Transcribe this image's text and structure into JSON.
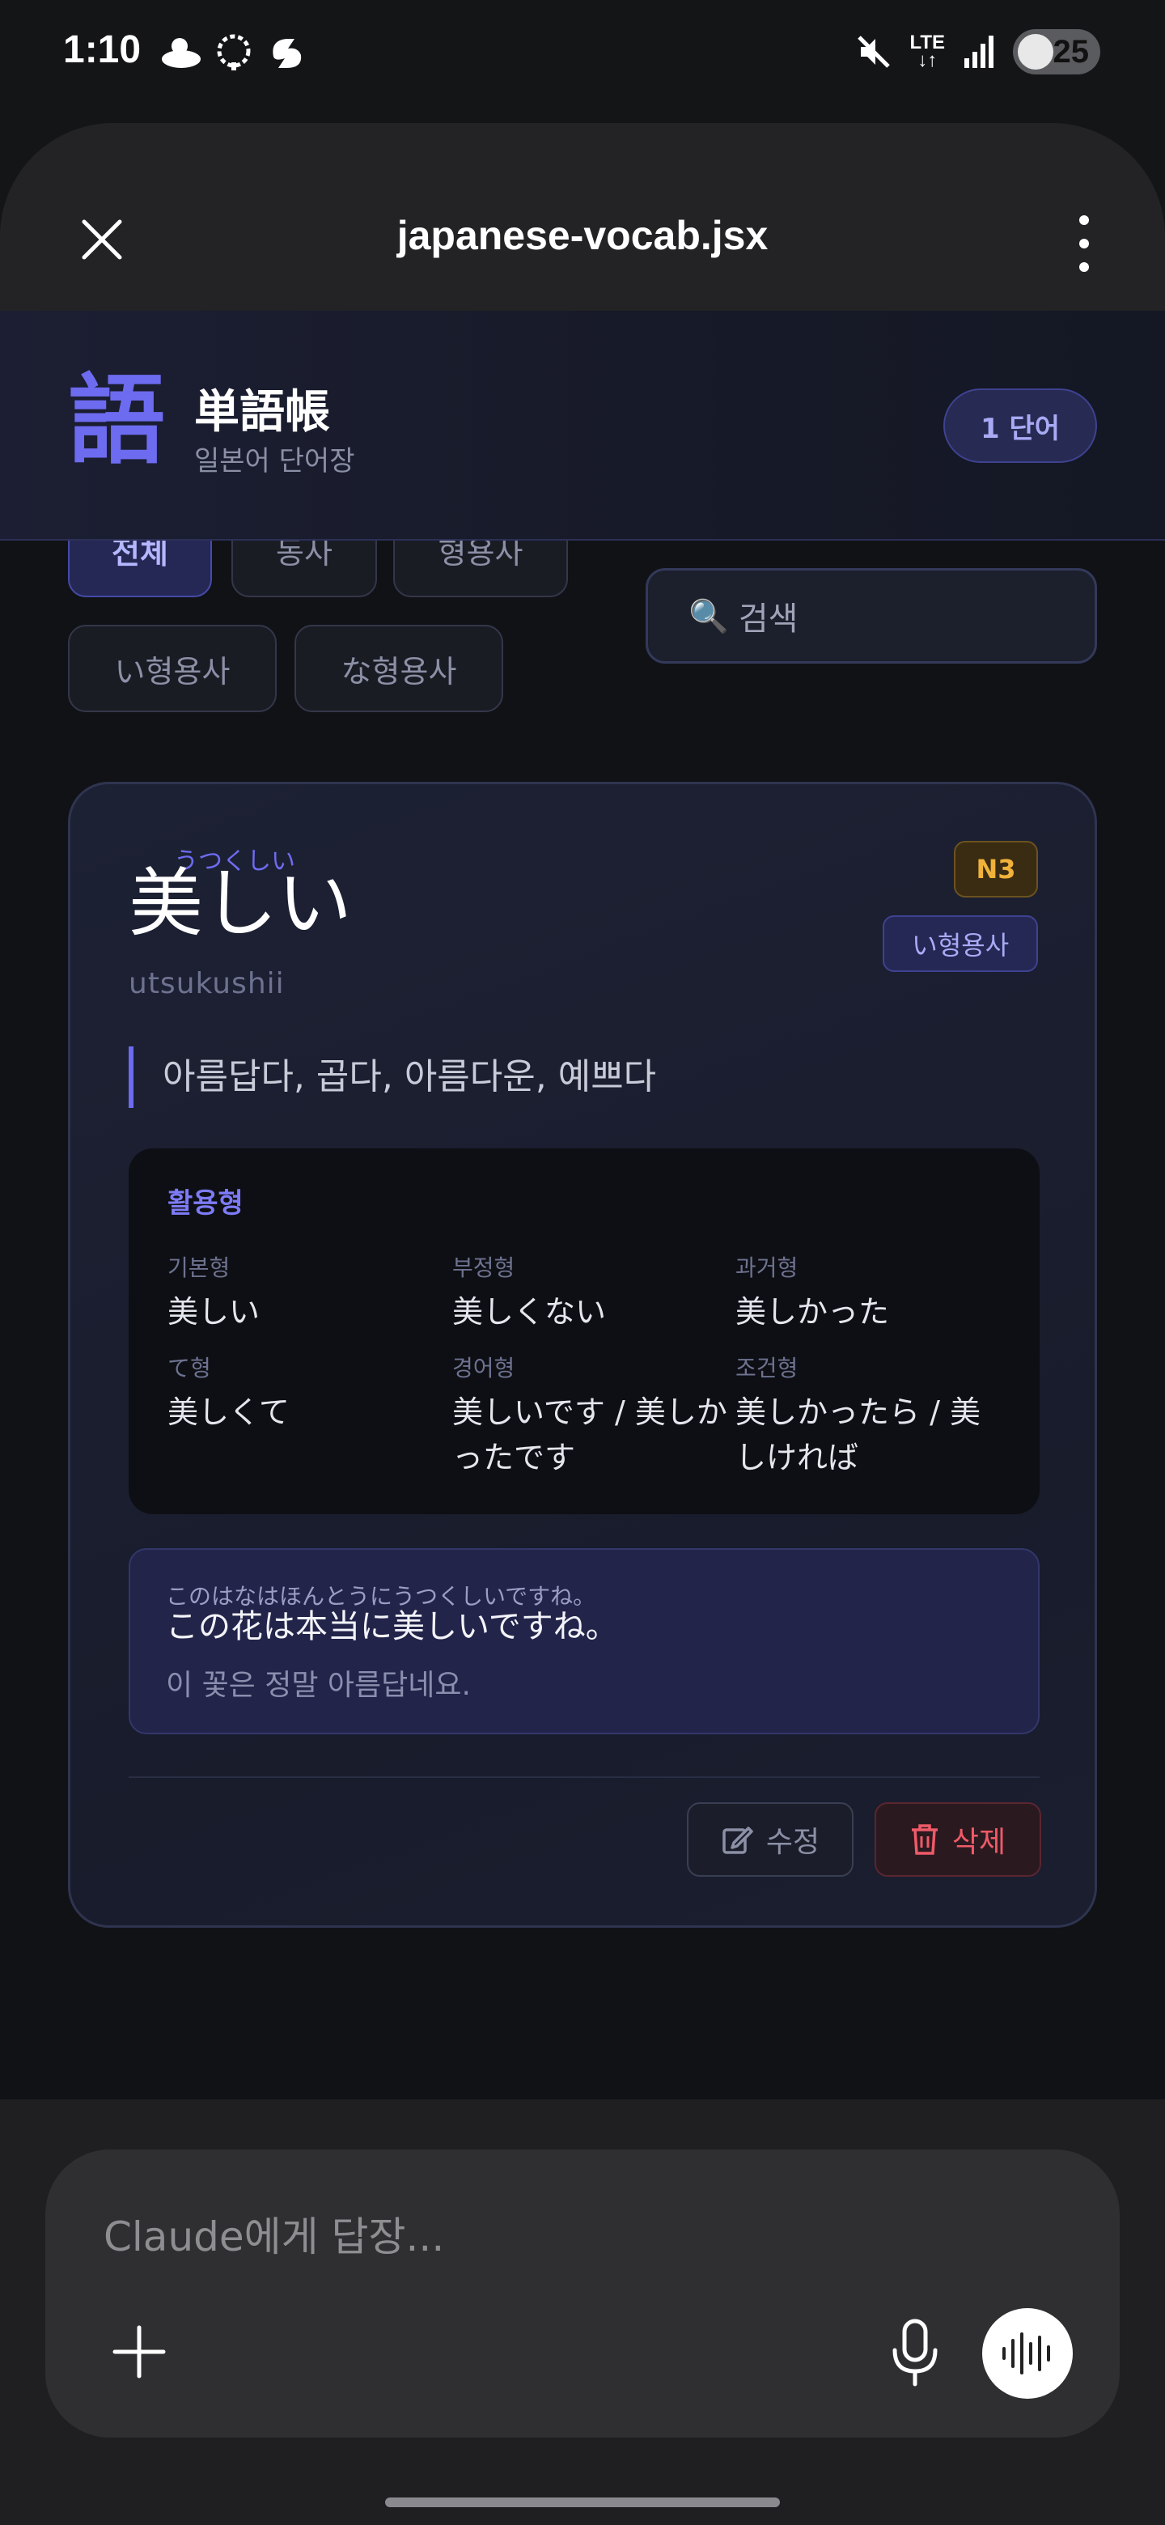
{
  "status_bar": {
    "time": "1:10",
    "network": "LTE",
    "battery": "25",
    "icons": [
      "cloud-sun-icon",
      "brain-icon",
      "sync-icon",
      "mute-icon",
      "signal-icon",
      "battery-icon"
    ]
  },
  "sheet": {
    "file_title": "japanese-vocab.jsx",
    "close_icon": "close-icon",
    "menu_icon": "more-vertical-icon"
  },
  "app": {
    "logo": "語",
    "title": "単語帳",
    "subtitle": "일본어 단어장",
    "count_badge": "1 단어",
    "accent": "#6d6bf0"
  },
  "filters": {
    "items": [
      {
        "label": "전체",
        "active": true
      },
      {
        "label": "동사",
        "active": false
      },
      {
        "label": "형용사",
        "active": false
      },
      {
        "label": "い형용사",
        "active": false
      },
      {
        "label": "な형용사",
        "active": false
      }
    ],
    "search_placeholder": "검색"
  },
  "card": {
    "reading": "うつくしい",
    "word": "美しい",
    "romaji": "utsukushii",
    "level": "N3",
    "type": "い형용사",
    "meaning": "아름답다, 곱다, 아름다운, 예쁘다",
    "conjugation": {
      "title": "활용형",
      "cells": [
        {
          "label": "기본형",
          "value": "美しい"
        },
        {
          "label": "부정형",
          "value": "美しくない"
        },
        {
          "label": "과거형",
          "value": "美しかった"
        },
        {
          "label": "て형",
          "value": "美しくて"
        },
        {
          "label": "경어형",
          "value": "美しいです / 美しかったです"
        },
        {
          "label": "조건형",
          "value": "美しかったら / 美しければ"
        }
      ]
    },
    "example": {
      "furigana": "このはなはほんとうにうつくしいですね。",
      "japanese": "この花は本当に美しいですね。",
      "korean": "이 꽃은 정말 아름답네요."
    },
    "edit_label": "수정",
    "delete_label": "삭제"
  },
  "reply": {
    "placeholder": "Claude에게 답장..."
  }
}
